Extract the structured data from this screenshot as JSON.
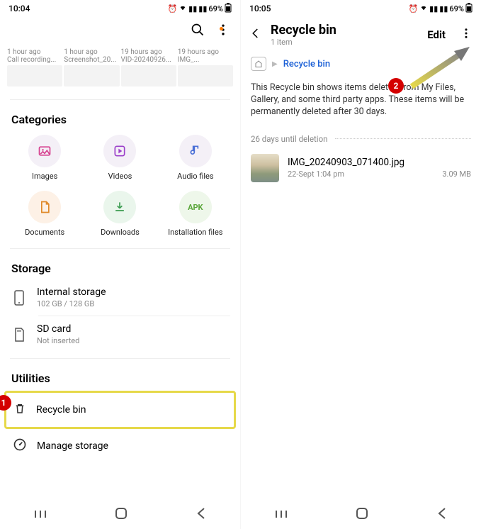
{
  "left": {
    "time": "10:04",
    "battery": "69%",
    "recent": [
      {
        "age": "1 hour ago",
        "name": "Call recording..."
      },
      {
        "age": "1 hour ago",
        "name": "Screenshot_20..."
      },
      {
        "age": "19 hours ago",
        "name": "VID-20240926..."
      },
      {
        "age": "19 hours ago",
        "name": "IMG_..."
      }
    ],
    "categories_title": "Categories",
    "categories": [
      {
        "label": "Images",
        "icon": "image"
      },
      {
        "label": "Videos",
        "icon": "play"
      },
      {
        "label": "Audio files",
        "icon": "note"
      },
      {
        "label": "Documents",
        "icon": "doc"
      },
      {
        "label": "Downloads",
        "icon": "download"
      },
      {
        "label": "Installation files",
        "icon": "apk"
      }
    ],
    "storage_title": "Storage",
    "storage": [
      {
        "title": "Internal storage",
        "sub": "102 GB / 128 GB",
        "icon": "phone"
      },
      {
        "title": "SD card",
        "sub": "Not inserted",
        "icon": "sd"
      }
    ],
    "utilities_title": "Utilities",
    "utilities": [
      {
        "label": "Recycle bin",
        "icon": "trash",
        "highlighted": true
      },
      {
        "label": "Manage storage",
        "icon": "gauge"
      }
    ],
    "badge1": "1"
  },
  "right": {
    "time": "10:05",
    "battery": "69%",
    "title": "Recycle bin",
    "subtitle": "1 item",
    "edit": "Edit",
    "breadcrumb_link": "Recycle bin",
    "desc": "This Recycle bin shows items deleted from My Files, Gallery, and some third party apps. These items will be permanently deleted after 30 days.",
    "deletion_header": "26 days until deletion",
    "file": {
      "name": "IMG_20240903_071400.jpg",
      "date": "22-Sept 1:04 pm",
      "size": "3.09 MB"
    },
    "badge2": "2"
  }
}
